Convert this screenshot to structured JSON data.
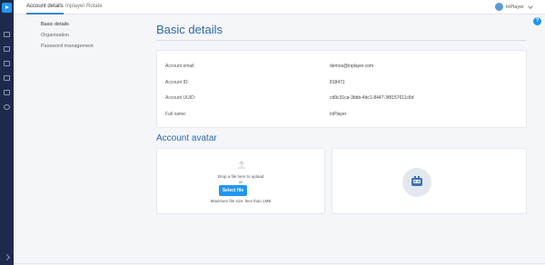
{
  "header": {
    "tabs": [
      {
        "label": "Account details"
      },
      {
        "label": "Inplayer Rotate"
      }
    ],
    "user_name": "InPlayer"
  },
  "help_label": "?",
  "subnav": {
    "items": [
      {
        "label": "Basic details"
      },
      {
        "label": "Organisation"
      },
      {
        "label": "Password management"
      }
    ]
  },
  "basic": {
    "title": "Basic details",
    "rows": [
      {
        "label": "Account email:",
        "value": "demos@inplayer.com"
      },
      {
        "label": "Account ID:",
        "value": "818471"
      },
      {
        "label": "Account UUID:",
        "value": "cd9c31ca-3bbb-4dc1-8447-3f8157611c8d"
      },
      {
        "label": "Full name:",
        "value": "InPlayer"
      }
    ]
  },
  "avatar": {
    "title": "Account avatar",
    "drop_text": "Drop a file here to upload",
    "or_text": "or",
    "button_label": "Select file",
    "size_note": "Maximum file size: less than 1MB"
  },
  "colors": {
    "accent": "#2196f3",
    "heading": "#2d68a8",
    "sidebar": "#1d2a4d"
  }
}
